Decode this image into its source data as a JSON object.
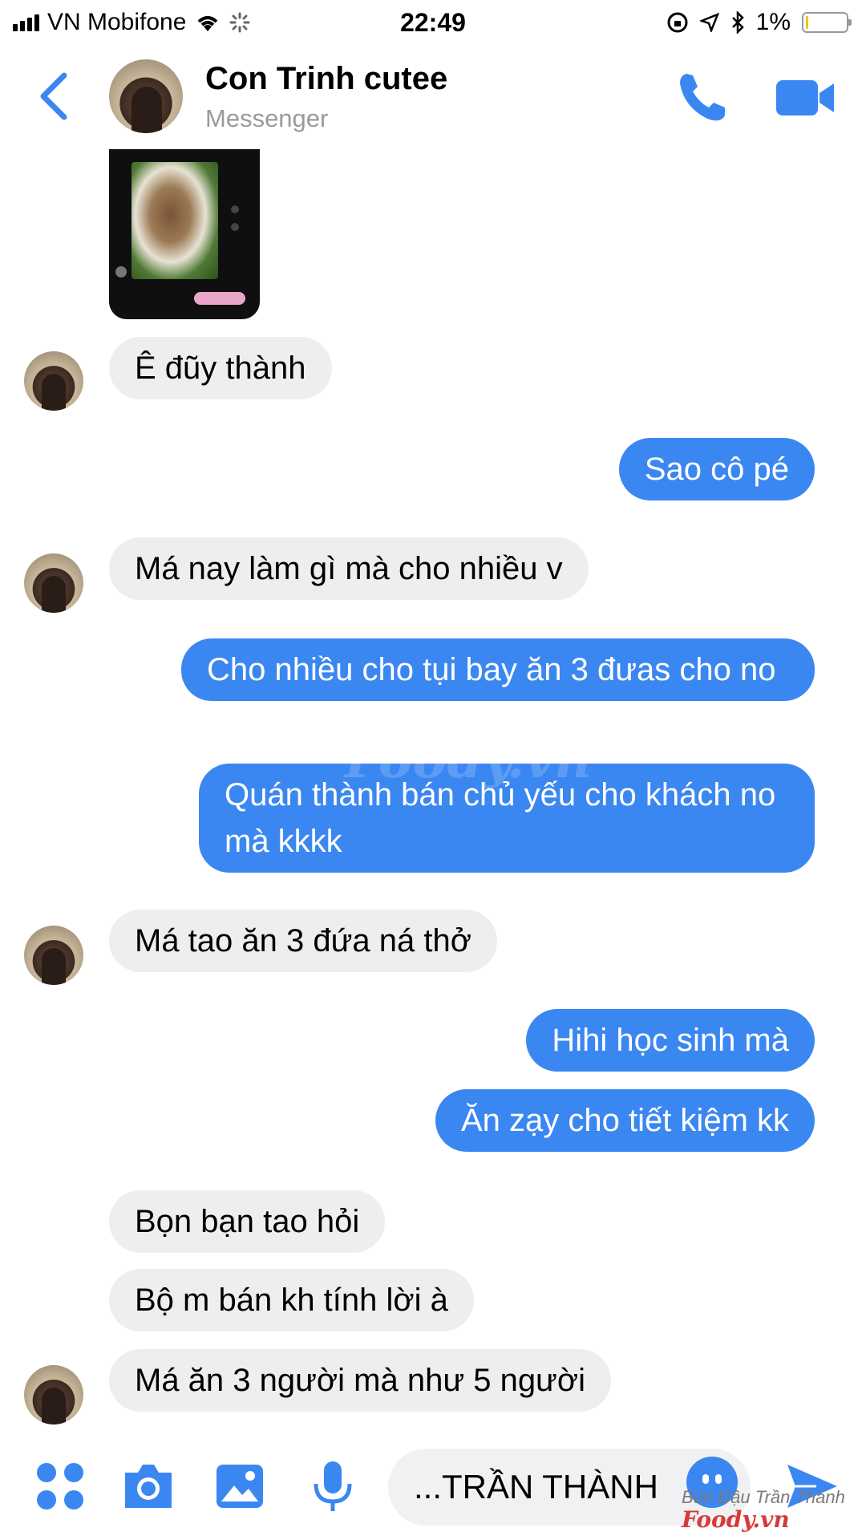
{
  "status_bar": {
    "carrier": "VN Mobifone",
    "time": "22:49",
    "battery_percent": "1%",
    "battery_level": 0.05
  },
  "header": {
    "contact_name": "Con Trinh cutee",
    "subtitle": "Messenger"
  },
  "messages": [
    {
      "from": "them",
      "text": "Ê đũy thành"
    },
    {
      "from": "me",
      "text": "Sao cô pé"
    },
    {
      "from": "them",
      "text": "Má nay làm gì mà cho nhiều v"
    },
    {
      "from": "me",
      "text": "Cho nhiều cho tụi bay ăn 3 đưas cho no"
    },
    {
      "from": "me",
      "text": "Quán thành bán chủ yếu cho khách no mà kkkk"
    },
    {
      "from": "them",
      "text": "Má tao ăn 3 đứa ná thở"
    },
    {
      "from": "me",
      "text": "Hihi học sinh mà"
    },
    {
      "from": "me",
      "text": "Ăn zạy cho tiết kiệm kk"
    },
    {
      "from": "them",
      "text": "Bọn bạn tao hỏi"
    },
    {
      "from": "them",
      "text": "Bộ m bán kh tính lời à"
    },
    {
      "from": "them",
      "text": "Má ăn 3 người mà như 5 người"
    }
  ],
  "composer": {
    "input_value": "...TRẦN THÀNH"
  },
  "watermark": {
    "center": "Foody.vn",
    "place": "Bún Đậu Trần Thành",
    "brand": "Foody.vn"
  },
  "colors": {
    "accent": "#3b87f2",
    "incoming_bubble": "#eeeeee"
  }
}
